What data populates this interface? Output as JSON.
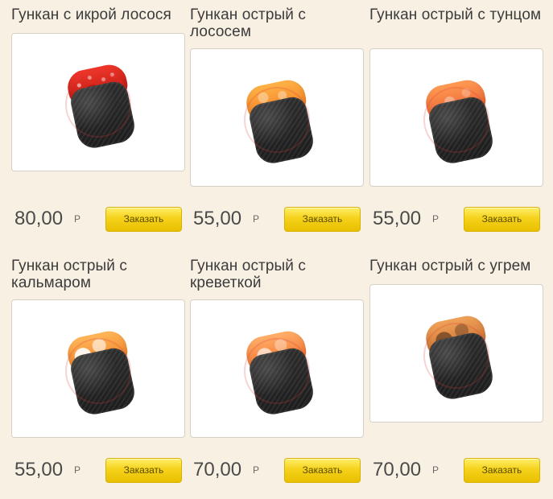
{
  "products": [
    {
      "title": "Гункан с икрой лосося",
      "price": "80,00",
      "currency": "Р",
      "order_label": "Заказать",
      "image_name": "gunkan-salmon-roe"
    },
    {
      "title": "Гункан острый с лососем",
      "price": "55,00",
      "currency": "Р",
      "order_label": "Заказать",
      "image_name": "gunkan-spicy-salmon"
    },
    {
      "title": "Гункан острый с тунцом",
      "price": "55,00",
      "currency": "Р",
      "order_label": "Заказать",
      "image_name": "gunkan-spicy-tuna"
    },
    {
      "title": "Гункан острый с кальмаром",
      "price": "55,00",
      "currency": "Р",
      "order_label": "Заказать",
      "image_name": "gunkan-spicy-squid"
    },
    {
      "title": "Гункан острый с креветкой",
      "price": "70,00",
      "currency": "Р",
      "order_label": "Заказать",
      "image_name": "gunkan-spicy-shrimp"
    },
    {
      "title": "Гункан острый с угрем",
      "price": "70,00",
      "currency": "Р",
      "order_label": "Заказать",
      "image_name": "gunkan-spicy-eel"
    }
  ],
  "colors": {
    "page_background": "#f8f1e3",
    "order_button_yellow": "#f5d21b"
  }
}
